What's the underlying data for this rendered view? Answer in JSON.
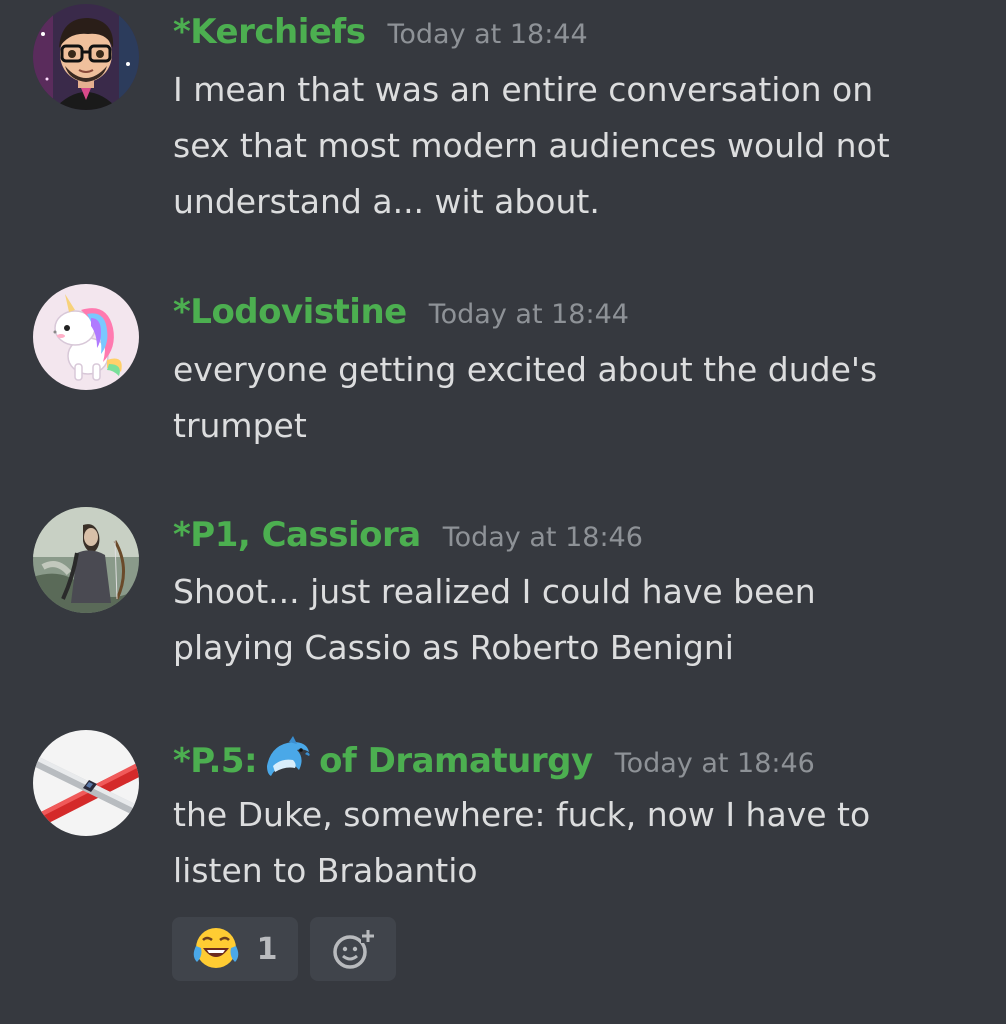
{
  "messages": [
    {
      "username": "*Kerchiefs",
      "timestamp": "Today at 18:44",
      "lines": [
        "I mean that was an entire conversation on",
        "sex that most modern audiences would not",
        "understand a... wit about."
      ]
    },
    {
      "username": "*Lodovistine",
      "timestamp": "Today at 18:44",
      "lines": [
        "everyone getting excited about the dude's",
        "trumpet"
      ]
    },
    {
      "username": "*P1, Cassiora",
      "timestamp": "Today at 18:46",
      "lines": [
        "Shoot... just realized I could have been",
        "playing Cassio as Roberto Benigni"
      ]
    },
    {
      "username_prefix": "*P.5:",
      "username_emoji": "dolphin-emoji",
      "username_suffix": "of Dramaturgy",
      "timestamp": "Today at 18:46",
      "lines": [
        "the Duke, somewhere: fuck, now I have to",
        "listen to Brabantio"
      ]
    }
  ],
  "reactions": [
    {
      "emoji": "joy-emoji",
      "count": "1"
    },
    {
      "icon": "add-reaction-icon"
    }
  ],
  "colors": {
    "background": "#36393f",
    "username": "#4caf50",
    "timestamp": "#8e9297",
    "text": "#dcddde",
    "reaction_bg": "#40444b"
  }
}
